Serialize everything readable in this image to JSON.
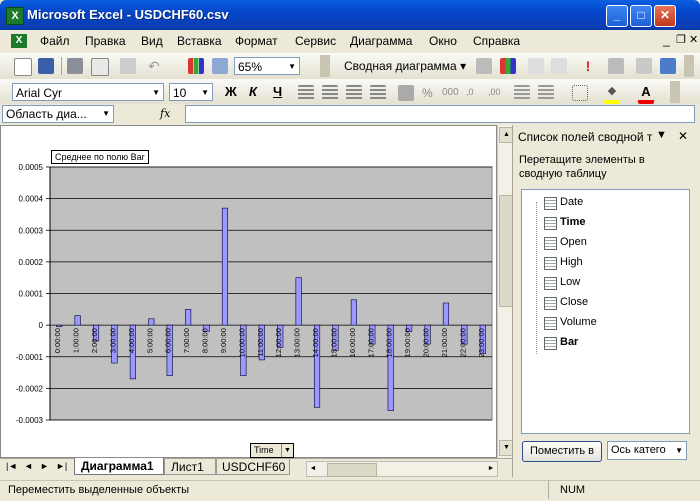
{
  "window": {
    "title": "Microsoft Excel - USDCHF60.csv"
  },
  "menu": [
    "Файл",
    "Правка",
    "Вид",
    "Вставка",
    "Формат",
    "Сервис",
    "Диаграмма",
    "Окно",
    "Справка"
  ],
  "toolbar": {
    "zoom": "65%",
    "pivot_label": "Сводная диаграмма ▾"
  },
  "format": {
    "font": "Arial Cyr",
    "size": "10",
    "bold": "Ж",
    "italic": "К",
    "underline": "Ч"
  },
  "formula": {
    "namebox": "Область диа...",
    "fx": "fx"
  },
  "chart_data": {
    "type": "bar",
    "title": "Среднее по полю  Bar",
    "field_button": "Time",
    "ylim": [
      -0.0003,
      0.0005
    ],
    "yticks": [
      "0.0005",
      "0.0004",
      "0.0003",
      "0.0002",
      "0.0001",
      "0",
      "-0.0001",
      "-0.0002",
      "-0.0003"
    ],
    "categories": [
      "0:00:00",
      "1:00:00",
      "2:00:00",
      "3:00:00",
      "4:00:00",
      "5:00:00",
      "6:00:00",
      "7:00:00",
      "8:00:00",
      "9:00:00",
      "10:00:00",
      "11:00:00",
      "12:00:00",
      "13:00:00",
      "14:00:00",
      "15:00:00",
      "16:00:00",
      "17:00:00",
      "18:00:00",
      "19:00:00",
      "20:00:00",
      "21:00:00",
      "22:00:00",
      "23:00:00"
    ],
    "values": [
      -5e-06,
      3e-05,
      -5e-05,
      -0.00012,
      -0.00017,
      2e-05,
      -0.00016,
      5e-05,
      -2e-05,
      0.00037,
      -0.00016,
      -0.00011,
      -7e-05,
      0.00015,
      -0.00026,
      -8e-05,
      8e-05,
      -6e-05,
      -0.00027,
      -2e-05,
      -6e-05,
      7e-05,
      -6e-05,
      -9e-05
    ]
  },
  "tabs": {
    "nav": [
      "|◄",
      "◄",
      "►",
      "►|"
    ],
    "sheets": [
      "Диаграмма1",
      "Лист1",
      "USDCHF60"
    ]
  },
  "status": {
    "left": "Переместить выделенные объекты",
    "num": "NUM"
  },
  "pane": {
    "title": "Список полей сводной т",
    "instruction": "Перетащите элементы в сводную таблицу",
    "fields": [
      "Date",
      "Time",
      "Open",
      "High",
      "Low",
      "Close",
      "Volume",
      "Bar"
    ],
    "bold_fields": [
      "Time",
      "Bar"
    ],
    "place_button": "Поместить в",
    "axis_select": "Ось катего"
  }
}
